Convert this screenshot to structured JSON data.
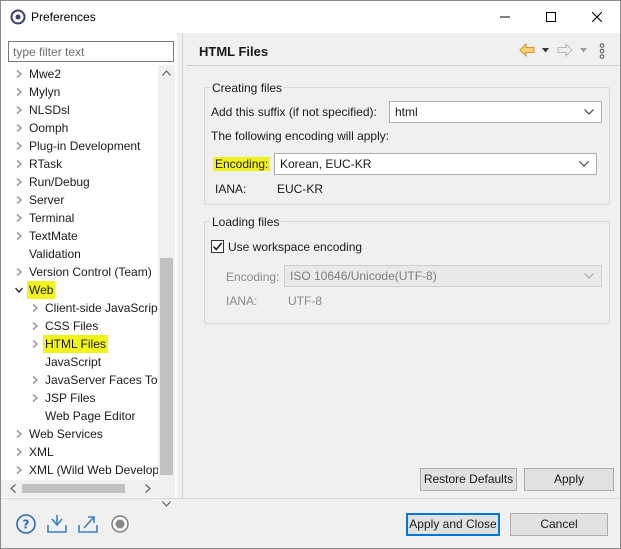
{
  "window": {
    "title": "Preferences"
  },
  "filter": {
    "placeholder": "type filter text"
  },
  "tree": {
    "items": [
      {
        "label": "Mwe2",
        "level": 0,
        "arrow": "right"
      },
      {
        "label": "Mylyn",
        "level": 0,
        "arrow": "right"
      },
      {
        "label": "NLSDsl",
        "level": 0,
        "arrow": "right"
      },
      {
        "label": "Oomph",
        "level": 0,
        "arrow": "right"
      },
      {
        "label": "Plug-in Development",
        "level": 0,
        "arrow": "right"
      },
      {
        "label": "RTask",
        "level": 0,
        "arrow": "right"
      },
      {
        "label": "Run/Debug",
        "level": 0,
        "arrow": "right"
      },
      {
        "label": "Server",
        "level": 0,
        "arrow": "right"
      },
      {
        "label": "Terminal",
        "level": 0,
        "arrow": "right"
      },
      {
        "label": "TextMate",
        "level": 0,
        "arrow": "right"
      },
      {
        "label": "Validation",
        "level": 0,
        "arrow": "none"
      },
      {
        "label": "Version Control (Team)",
        "level": 0,
        "arrow": "right"
      },
      {
        "label": "Web",
        "level": 0,
        "arrow": "down",
        "highlight": true
      },
      {
        "label": "Client-side JavaScript",
        "level": 1,
        "arrow": "right"
      },
      {
        "label": "CSS Files",
        "level": 1,
        "arrow": "right"
      },
      {
        "label": "HTML Files",
        "level": 1,
        "arrow": "right",
        "highlight": true
      },
      {
        "label": "JavaScript",
        "level": 1,
        "arrow": "none"
      },
      {
        "label": "JavaServer Faces Tools",
        "level": 1,
        "arrow": "right"
      },
      {
        "label": "JSP Files",
        "level": 1,
        "arrow": "right"
      },
      {
        "label": "Web Page Editor",
        "level": 1,
        "arrow": "none"
      },
      {
        "label": "Web Services",
        "level": 0,
        "arrow": "right"
      },
      {
        "label": "XML",
        "level": 0,
        "arrow": "right"
      },
      {
        "label": "XML (Wild Web Developer)",
        "level": 0,
        "arrow": "right"
      }
    ]
  },
  "page": {
    "title": "HTML Files"
  },
  "creating": {
    "group_title": "Creating files",
    "suffix_label": "Add this suffix (if not specified):",
    "suffix_value": "html",
    "encoding_note": "The following encoding will apply:",
    "encoding_label": "Encoding:",
    "encoding_value": "Korean, EUC-KR",
    "iana_label": "IANA:",
    "iana_value": "EUC-KR"
  },
  "loading": {
    "group_title": "Loading files",
    "workspace_label": "Use workspace encoding",
    "workspace_checked": true,
    "encoding_label": "Encoding:",
    "encoding_value": "ISO 10646/Unicode(UTF-8)",
    "iana_label": "IANA:",
    "iana_value": "UTF-8"
  },
  "buttons": {
    "restore_defaults": "Restore Defaults",
    "apply": "Apply",
    "apply_close": "Apply and Close",
    "cancel": "Cancel"
  },
  "colors": {
    "highlight": "#f3f31c",
    "accent": "#0078d7",
    "nav_back": "#e8a33c"
  },
  "icons": {
    "bottom": [
      "help-icon",
      "import-icon",
      "export-icon",
      "record-icon"
    ]
  }
}
